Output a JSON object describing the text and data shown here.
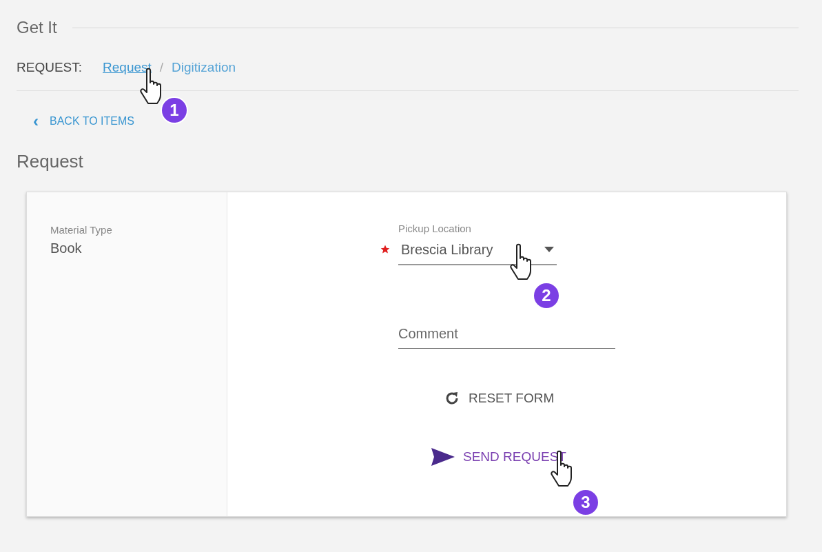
{
  "section_title": "Get It",
  "request_bar": {
    "label": "REQUEST:",
    "separator": "/",
    "options": [
      {
        "label": "Request",
        "selected": true,
        "step": "1"
      },
      {
        "label": "Digitization",
        "selected": false
      }
    ]
  },
  "back_link": {
    "icon": "‹",
    "label": "BACK TO ITEMS"
  },
  "form_title": "Request",
  "details": [
    {
      "label": "Material Type",
      "value": "Book"
    }
  ],
  "fields": [
    {
      "kind": "select",
      "label": "Pickup Location",
      "value": "Brescia Library",
      "required": true,
      "step": "2"
    },
    {
      "kind": "text",
      "placeholder": "Comment"
    }
  ],
  "buttons": [
    {
      "kind": "reset",
      "label": "RESET FORM"
    },
    {
      "kind": "send",
      "label": "SEND REQUEST",
      "step": "3"
    }
  ]
}
